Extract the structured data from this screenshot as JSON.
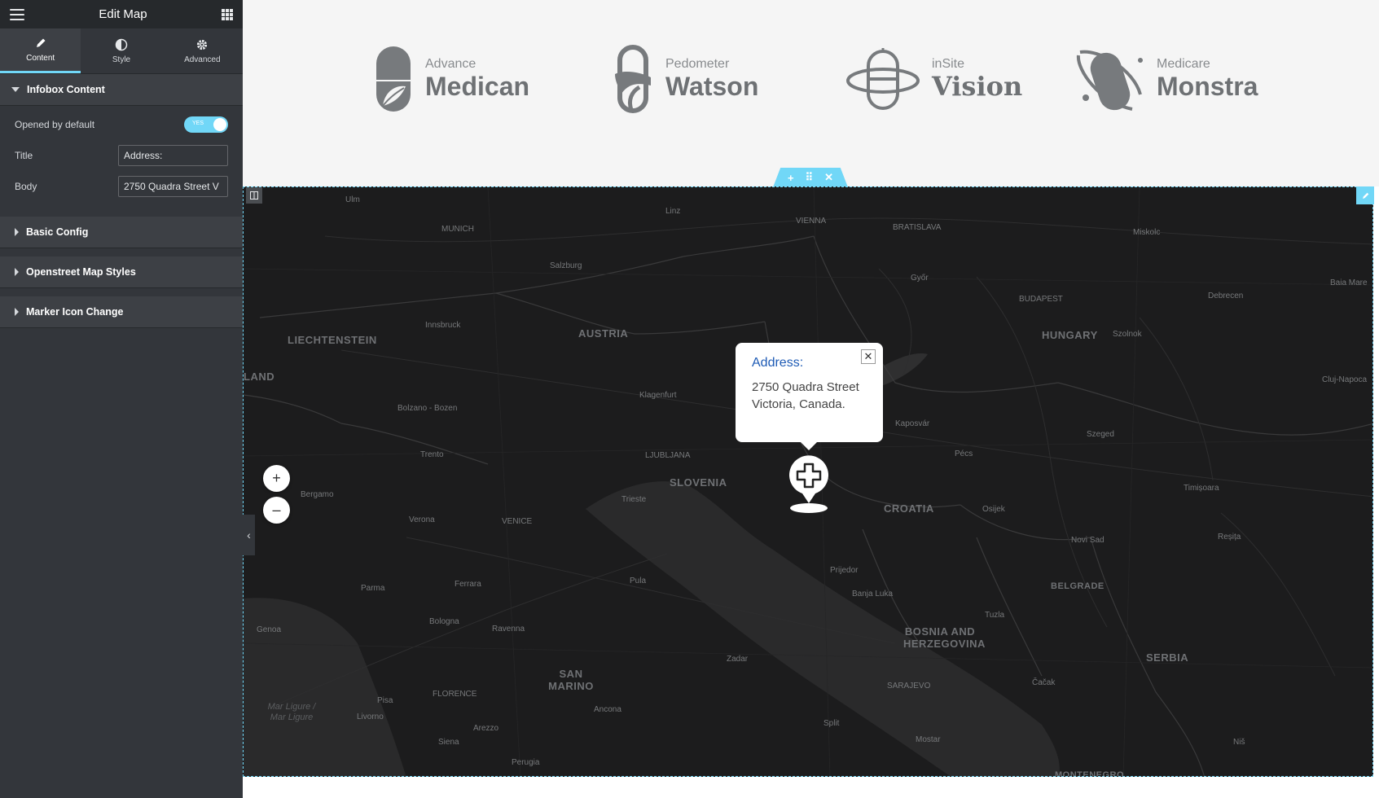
{
  "sidebar": {
    "title": "Edit Map",
    "tabs": [
      {
        "label": "Content",
        "icon": "pencil-icon",
        "active": true
      },
      {
        "label": "Style",
        "icon": "half-circle-icon",
        "active": false
      },
      {
        "label": "Advanced",
        "icon": "gear-icon",
        "active": false
      }
    ],
    "infobox_section": {
      "label": "Infobox Content",
      "opened_label": "Opened by default",
      "opened_toggle_text": "YES",
      "title_label": "Title",
      "title_value": "Address:",
      "body_label": "Body",
      "body_value": "2750 Quadra Street V"
    },
    "sections": [
      {
        "label": "Basic Config"
      },
      {
        "label": "Openstreet Map Styles"
      },
      {
        "label": "Marker Icon Change"
      }
    ],
    "accent_color": "#71d7f7"
  },
  "logos": [
    {
      "sub": "Advance",
      "name": "Medican",
      "icon": "leaf-capsule-icon"
    },
    {
      "sub": "Pedometer",
      "name": "Watson",
      "icon": "capsule-outline-icon"
    },
    {
      "sub": "inSite",
      "name": "Vision",
      "icon": "capsule-orbit-icon"
    },
    {
      "sub": "Medicare",
      "name": "Monstra",
      "icon": "planet-capsule-icon"
    }
  ],
  "section_handle": {
    "add": "+",
    "move": "⠿",
    "remove": "✕"
  },
  "map": {
    "zoom_in": "+",
    "zoom_out": "–",
    "infobox": {
      "title": "Address:",
      "body": "2750 Quadra Street Victoria, Canada.",
      "close": "✕"
    },
    "labels": {
      "countries": [
        "AUSTRIA",
        "HUNGARY",
        "SLOVENIA",
        "CROATIA",
        "LIECHTENSTEIN",
        "BOSNIA AND HERZEGOVINA",
        "SERBIA",
        "SAN MARINO"
      ],
      "cities": [
        "Ulm",
        "MUNICH",
        "Linz",
        "VIENNA",
        "BRATISLAVA",
        "Miskolc",
        "Salzburg",
        "Győr",
        "BUDAPEST",
        "Debrecen",
        "Baia Mare",
        "Innsbruck",
        "Szolnok",
        "LAND",
        "Bolzano - Bozen",
        "Klagenfurt",
        "Cluj-Napoca",
        "Kaposvár",
        "Szeged",
        "Trento",
        "LJUBLJANA",
        "Pécs",
        "Bergamo",
        "Trieste",
        "Timișoara",
        "Verona",
        "VENICE",
        "Osijek",
        "Novi Sad",
        "Reșița",
        "Pula",
        "Prijedor",
        "Parma",
        "Ferrara",
        "Banja Luka",
        "BELGRADE",
        "Bologna",
        "Ravenna",
        "Tuzla",
        "Genoa",
        "Zadar",
        "SARAJEVO",
        "Čačak",
        "Pisa",
        "FLORENCE",
        "Livorno",
        "Ancona",
        "Arezzo",
        "Split",
        "Mostar",
        "Siena",
        "Niš",
        "Perugia",
        "MONTENEGRO"
      ],
      "sea": "Mar Ligure / Mar Ligure"
    }
  }
}
